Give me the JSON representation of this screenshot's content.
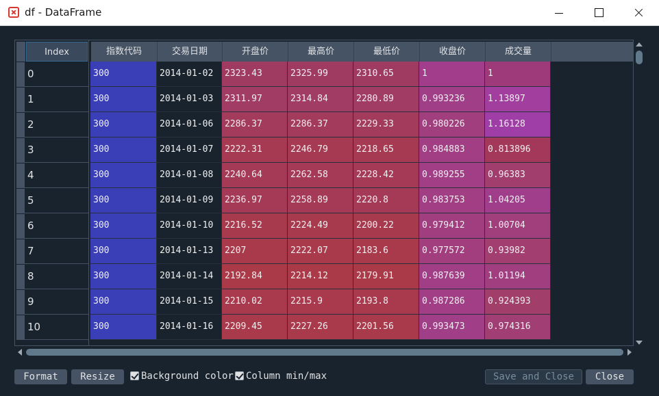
{
  "window": {
    "title": "df - DataFrame"
  },
  "table": {
    "index_header": "Index",
    "columns": [
      "指数代码",
      "交易日期",
      "开盘价",
      "最高价",
      "最低价",
      "收盘价",
      "成交量"
    ],
    "rows": [
      {
        "index": "0",
        "cells": [
          "300",
          "2014-01-02",
          "2323.43",
          "2325.99",
          "2310.65",
          "1",
          "1"
        ]
      },
      {
        "index": "1",
        "cells": [
          "300",
          "2014-01-03",
          "2311.97",
          "2314.84",
          "2280.89",
          "0.993236",
          "1.13897"
        ]
      },
      {
        "index": "2",
        "cells": [
          "300",
          "2014-01-06",
          "2286.37",
          "2286.37",
          "2229.33",
          "0.980226",
          "1.16128"
        ]
      },
      {
        "index": "3",
        "cells": [
          "300",
          "2014-01-07",
          "2222.31",
          "2246.79",
          "2218.65",
          "0.984883",
          "0.813896"
        ]
      },
      {
        "index": "4",
        "cells": [
          "300",
          "2014-01-08",
          "2240.64",
          "2262.58",
          "2228.42",
          "0.989255",
          "0.96383"
        ]
      },
      {
        "index": "5",
        "cells": [
          "300",
          "2014-01-09",
          "2236.97",
          "2258.89",
          "2220.8",
          "0.983753",
          "1.04205"
        ]
      },
      {
        "index": "6",
        "cells": [
          "300",
          "2014-01-10",
          "2216.52",
          "2224.49",
          "2200.22",
          "0.979412",
          "1.00704"
        ]
      },
      {
        "index": "7",
        "cells": [
          "300",
          "2014-01-13",
          "2207",
          "2222.07",
          "2183.6",
          "0.977572",
          "0.93982"
        ]
      },
      {
        "index": "8",
        "cells": [
          "300",
          "2014-01-14",
          "2192.84",
          "2214.12",
          "2179.91",
          "0.987639",
          "1.01194"
        ]
      },
      {
        "index": "9",
        "cells": [
          "300",
          "2014-01-15",
          "2210.02",
          "2215.9",
          "2193.8",
          "0.987286",
          "0.924393"
        ]
      },
      {
        "index": "10",
        "cells": [
          "300",
          "2014-01-16",
          "2209.45",
          "2227.26",
          "2201.56",
          "0.993473",
          "0.974316"
        ]
      }
    ],
    "cell_colors": [
      [
        "#3a3fb8",
        "#19232d",
        "#9f3a60",
        "#9f3a60",
        "#9f3a60",
        "#a13d8a",
        "#9f3a7a"
      ],
      [
        "#3a3fb8",
        "#19232d",
        "#a13d64",
        "#a13d64",
        "#a13d64",
        "#a13e88",
        "#a13e9e"
      ],
      [
        "#3a3fb8",
        "#19232d",
        "#a33c5c",
        "#a33c5c",
        "#a33c5c",
        "#a13e7e",
        "#9f3ea6"
      ],
      [
        "#3a3fb8",
        "#19232d",
        "#a63a52",
        "#a63a52",
        "#a63a52",
        "#a13e84",
        "#a4385a"
      ],
      [
        "#3a3fb8",
        "#19232d",
        "#a53a56",
        "#a53a56",
        "#a53a56",
        "#a13e86",
        "#a13e6e"
      ],
      [
        "#3a3fb8",
        "#19232d",
        "#a53a56",
        "#a53a56",
        "#a53a56",
        "#a13e84",
        "#a13e8c"
      ],
      [
        "#3a3fb8",
        "#19232d",
        "#a83a4e",
        "#a83a4e",
        "#a83a4e",
        "#a13e80",
        "#a13e7c"
      ],
      [
        "#3a3fb8",
        "#19232d",
        "#a93a4c",
        "#a93a4c",
        "#a93a4c",
        "#a33e7e",
        "#a33e70"
      ],
      [
        "#3a3fb8",
        "#19232d",
        "#ab3a48",
        "#ab3a48",
        "#ab3a48",
        "#a13e86",
        "#a13e80"
      ],
      [
        "#3a3fb8",
        "#19232d",
        "#a93a4e",
        "#a93a4e",
        "#a93a4e",
        "#a13e86",
        "#a13e6a"
      ],
      [
        "#3a3fb8",
        "#19232d",
        "#a93a4c",
        "#a93a4c",
        "#a93a4c",
        "#a13e88",
        "#a13e74"
      ]
    ]
  },
  "controls": {
    "format_label": "Format",
    "resize_label": "Resize",
    "background_color_label": "Background color",
    "background_color_checked": true,
    "column_minmax_label": "Column min/max",
    "column_minmax_checked": true,
    "save_close_label": "Save and Close",
    "close_label": "Close"
  },
  "icons": {
    "app": "spyder-logo-icon",
    "minimize": "minimize-icon",
    "maximize": "maximize-icon",
    "close": "close-icon"
  }
}
